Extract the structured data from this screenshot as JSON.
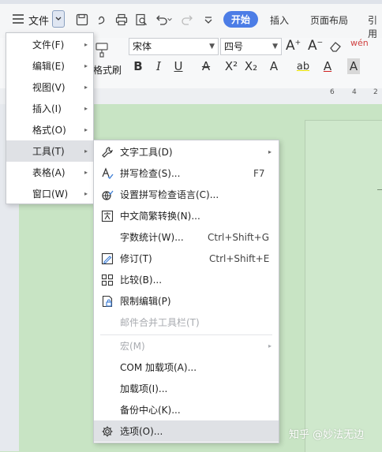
{
  "toolbar": {
    "file_label": "文件",
    "tab_start": "开始",
    "tab_insert": "插入",
    "tab_layout": "页面布局",
    "tab_ref": "引用"
  },
  "ribbon": {
    "font_name": "宋体",
    "font_size": "四号",
    "format_painter": "格式刷",
    "ruler_6": "6",
    "ruler_4": "4",
    "ruler_2": "2"
  },
  "left_menu": [
    {
      "label": "文件(F)"
    },
    {
      "label": "编辑(E)"
    },
    {
      "label": "视图(V)"
    },
    {
      "label": "插入(I)"
    },
    {
      "label": "格式(O)"
    },
    {
      "label": "工具(T)"
    },
    {
      "label": "表格(A)"
    },
    {
      "label": "窗口(W)"
    }
  ],
  "tools_menu": [
    {
      "label": "文字工具(D)",
      "shortcut": "",
      "icon": "wrench-icon"
    },
    {
      "label": "拼写检查(S)...",
      "shortcut": "F7",
      "icon": "spell-check-icon"
    },
    {
      "label": "设置拼写检查语言(C)...",
      "shortcut": "",
      "icon": "globe-spell-icon"
    },
    {
      "label": "中文简繁转换(N)...",
      "shortcut": "",
      "icon": "convert-chinese-icon"
    },
    {
      "label": "字数统计(W)...",
      "shortcut": "Ctrl+Shift+G",
      "icon": ""
    },
    {
      "label": "修订(T)",
      "shortcut": "Ctrl+Shift+E",
      "icon": "track-changes-icon"
    },
    {
      "label": "比较(B)...",
      "shortcut": "",
      "icon": "compare-icon"
    },
    {
      "label": "限制编辑(P)",
      "shortcut": "",
      "icon": "restrict-edit-icon"
    },
    {
      "label": "邮件合并工具栏(T)",
      "shortcut": "",
      "icon": ""
    },
    {
      "label": "宏(M)",
      "shortcut": "",
      "icon": ""
    },
    {
      "label": "COM 加载项(A)...",
      "shortcut": "",
      "icon": ""
    },
    {
      "label": "加载项(I)...",
      "shortcut": "",
      "icon": ""
    },
    {
      "label": "备份中心(K)...",
      "shortcut": "",
      "icon": ""
    },
    {
      "label": "选项(O)...",
      "shortcut": "",
      "icon": "gear-icon"
    }
  ],
  "watermark": "知乎 @妙法无边",
  "colors": {
    "accent": "#4c7de6",
    "doc_bg": "#c8e4c4",
    "highlight": "#dfe1e5"
  }
}
